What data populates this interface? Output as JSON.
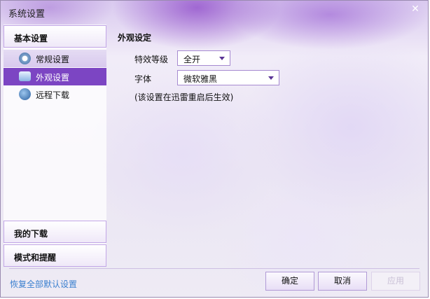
{
  "window": {
    "title": "系统设置",
    "close": "✕"
  },
  "sidebar": {
    "basic": "基本设置",
    "items": [
      {
        "label": "常规设置",
        "icon": "gear-icon"
      },
      {
        "label": "外观设置",
        "icon": "shirt-icon",
        "selected": true
      },
      {
        "label": "远程下载",
        "icon": "remote-download-icon"
      }
    ],
    "my_downloads": "我的下载",
    "modes": "模式和提醒"
  },
  "main": {
    "heading": "外观设定",
    "effect_label": "特效等级",
    "effect_value": "全开",
    "font_label": "字体",
    "font_value": "微软雅黑",
    "note": "(该设置在迅雷重启后生效)"
  },
  "footer": {
    "restore": "恢复全部默认设置",
    "ok": "确定",
    "cancel": "取消",
    "apply": "应用"
  }
}
